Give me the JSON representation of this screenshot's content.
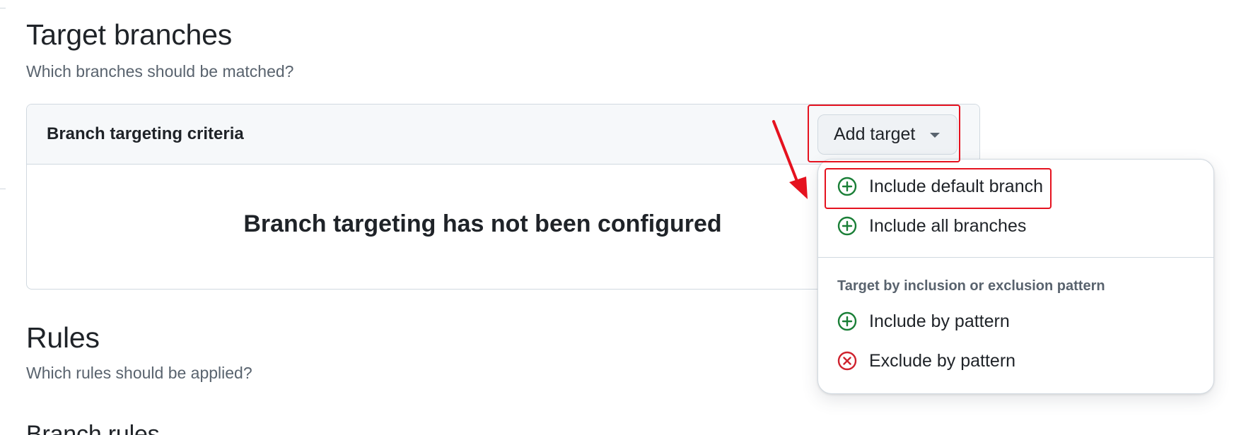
{
  "sections": {
    "target": {
      "title": "Target branches",
      "subtitle": "Which branches should be matched?"
    },
    "rules": {
      "title": "Rules",
      "subtitle": "Which rules should be applied?"
    },
    "branch_rules": {
      "title": "Branch rules"
    }
  },
  "targeting_box": {
    "header_label": "Branch targeting criteria",
    "empty_message": "Branch targeting has not been configured"
  },
  "add_target_button": {
    "label": "Add target",
    "icon": "triangle-down-icon"
  },
  "menu": {
    "items": [
      {
        "label": "Include default branch",
        "icon": "plus-circle-icon"
      },
      {
        "label": "Include all branches",
        "icon": "plus-circle-icon"
      }
    ],
    "group_label": "Target by inclusion or exclusion pattern",
    "pattern_items": [
      {
        "label": "Include by pattern",
        "icon": "plus-circle-icon"
      },
      {
        "label": "Exclude by pattern",
        "icon": "x-circle-icon"
      }
    ]
  },
  "colors": {
    "include": "#1a7f37",
    "exclude": "#cf222e",
    "annotation": "#e5121f"
  }
}
